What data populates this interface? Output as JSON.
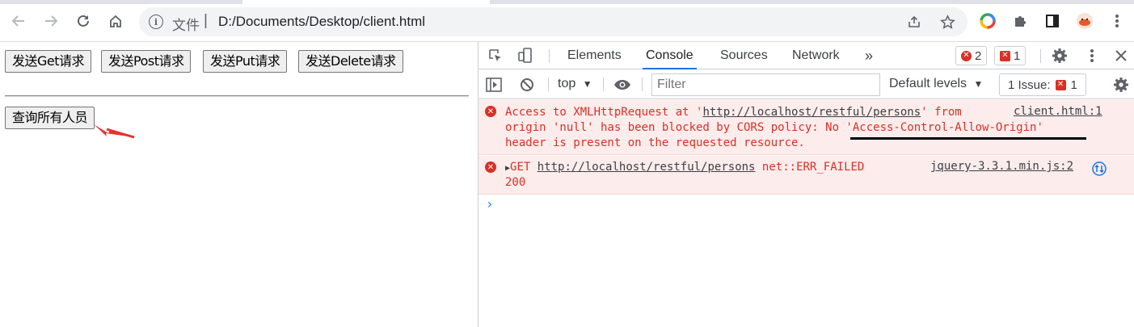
{
  "browser": {
    "omnibox": {
      "site_label": "文件",
      "separator": "|",
      "url": "D:/Documents/Desktop/client.html"
    }
  },
  "page": {
    "buttons": [
      {
        "label": "发送Get请求"
      },
      {
        "label": "发送Post请求"
      },
      {
        "label": "发送Put请求"
      },
      {
        "label": "发送Delete请求"
      }
    ],
    "query_button": {
      "label": "查询所有人员"
    }
  },
  "devtools": {
    "tabs": [
      {
        "label": "Elements"
      },
      {
        "label": "Console"
      },
      {
        "label": "Sources"
      },
      {
        "label": "Network"
      }
    ],
    "more_tabs": "»",
    "error_count": "2",
    "warning_count": "1",
    "console_bar": {
      "context": "top",
      "filter_placeholder": "Filter",
      "levels": "Default levels",
      "issues_label": "1 Issue:",
      "issues_count": "1"
    },
    "messages": [
      {
        "line1_a": "Access to XMLHttpRequest at '",
        "line1_link": "http://localhost/restful/persons",
        "line1_b": "' from",
        "line2": "origin 'null' has been blocked by CORS policy: No 'Access-Control-Allow-Origin'",
        "line3": "header is present on the requested resource.",
        "source": "client.html:1"
      },
      {
        "method": "GET",
        "link": "http://localhost/restful/persons",
        "status_text": "net::ERR_FAILED",
        "line2": "200",
        "source": "jquery-3.3.1.min.js:2"
      }
    ]
  },
  "colors": {
    "error_red": "#d93025",
    "error_bg": "#fcecec",
    "accent_blue": "#1a73e8",
    "annotation_red": "#e8322c"
  }
}
